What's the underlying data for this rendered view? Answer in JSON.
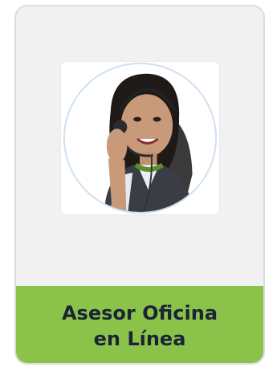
{
  "card": {
    "title_line_1": "Asesor Oficina",
    "title_line_2": "en Línea",
    "banner_color": "#8bc34a",
    "avatar_icon": "support-agent-headset-photo"
  }
}
